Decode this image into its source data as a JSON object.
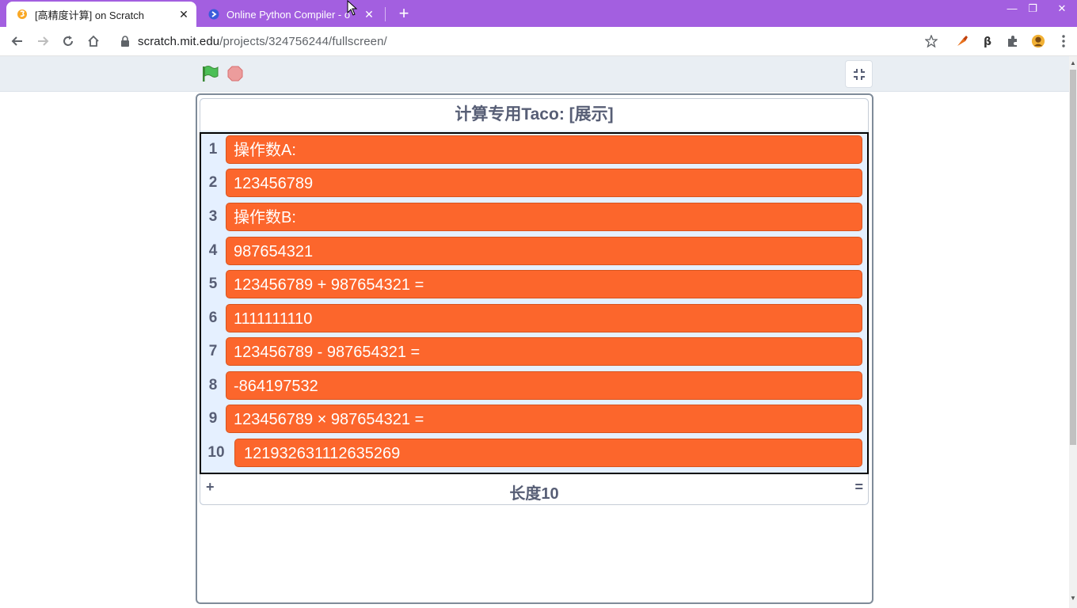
{
  "browser": {
    "tabs": [
      {
        "title": "[高精度计算] on Scratch",
        "active": true,
        "favicon": "scratch-cat-icon"
      },
      {
        "title": "Online Python Compiler - o",
        "active": false,
        "favicon": "compiler-icon"
      }
    ],
    "new_tab_symbol": "+",
    "close_symbol": "✕",
    "window_controls": {
      "minimize": "—",
      "restore": "❐",
      "close": "✕"
    },
    "address": {
      "host": "scratch.mit.edu",
      "path": "/projects/324756244/fullscreen/"
    },
    "colors": {
      "tab_strip": "#a35fe0"
    }
  },
  "scratch": {
    "controls": {
      "green_flag": "green-flag-icon",
      "stop": "stop-sign-icon",
      "exit_fullscreen": "exit-fullscreen-icon"
    },
    "list": {
      "title": "计算专用Taco: [展示]",
      "items": [
        {
          "index": "1",
          "value": "操作数A:"
        },
        {
          "index": "2",
          "value": "123456789"
        },
        {
          "index": "3",
          "value": "操作数B:"
        },
        {
          "index": "4",
          "value": "987654321"
        },
        {
          "index": "5",
          "value": "123456789 + 987654321 ="
        },
        {
          "index": "6",
          "value": "1111111110"
        },
        {
          "index": "7",
          "value": "123456789 - 987654321 ="
        },
        {
          "index": "8",
          "value": "-864197532"
        },
        {
          "index": "9",
          "value": "123456789 × 987654321 ="
        },
        {
          "index": "10",
          "value": "121932631112635269"
        }
      ],
      "add_symbol": "+",
      "length_label": "长度10",
      "resize_symbol": "=",
      "colors": {
        "item_bg": "#fc662c",
        "list_bg": "#e5f0ff",
        "text": "#575e75"
      }
    }
  }
}
